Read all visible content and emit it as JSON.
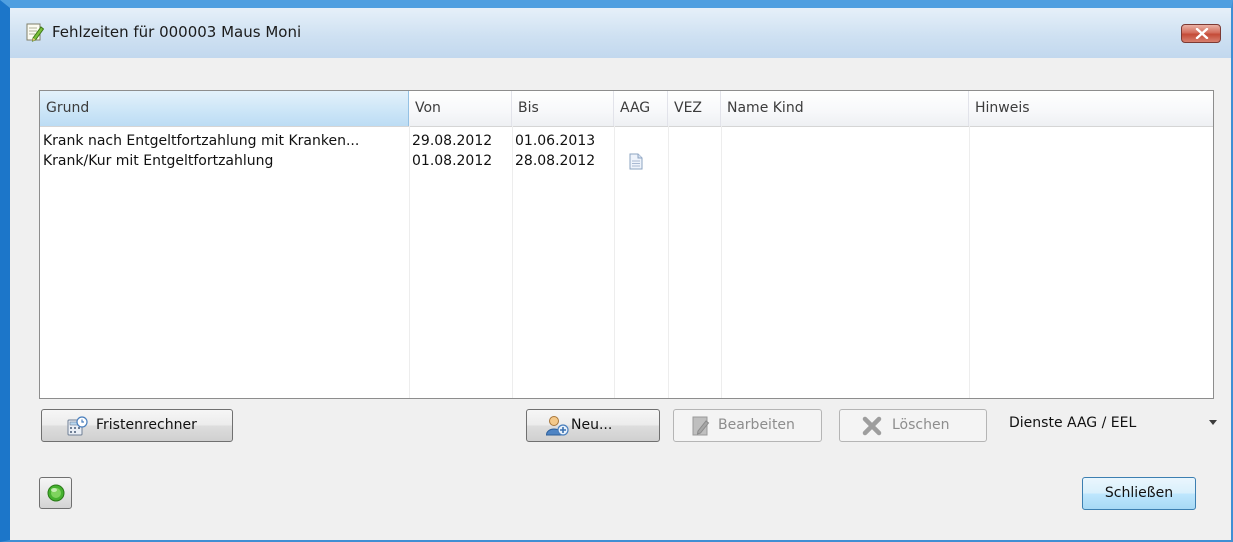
{
  "window": {
    "title": "Fehlzeiten für 000003 Maus Moni",
    "icon": "note-edit-icon",
    "close_icon": "close-icon"
  },
  "table": {
    "columns": [
      "Grund",
      "Von",
      "Bis",
      "AAG",
      "VEZ",
      "Name Kind",
      "Hinweis"
    ],
    "rows": [
      {
        "grund": "Krank nach Entgeltfortzahlung mit Kranken...",
        "von": "29.08.2012",
        "bis": "01.06.2013",
        "aag_icon": "",
        "vez": "",
        "name_kind": "",
        "hinweis": ""
      },
      {
        "grund": "Krank/Kur mit Entgeltfortzahlung",
        "von": "01.08.2012",
        "bis": "28.08.2012",
        "aag_icon": "document-icon",
        "vez": "",
        "name_kind": "",
        "hinweis": ""
      }
    ]
  },
  "buttons": {
    "fristenrechner": "Fristenrechner",
    "neu": "Neu...",
    "bearbeiten": "Bearbeiten",
    "loeschen": "Löschen",
    "dienste": "Dienste AAG / EEL",
    "schliessen": "Schließen"
  },
  "colors": {
    "window_border": "#1c76c9",
    "sorted_header": "#cbe5f7",
    "close_button": "#c44b38"
  }
}
